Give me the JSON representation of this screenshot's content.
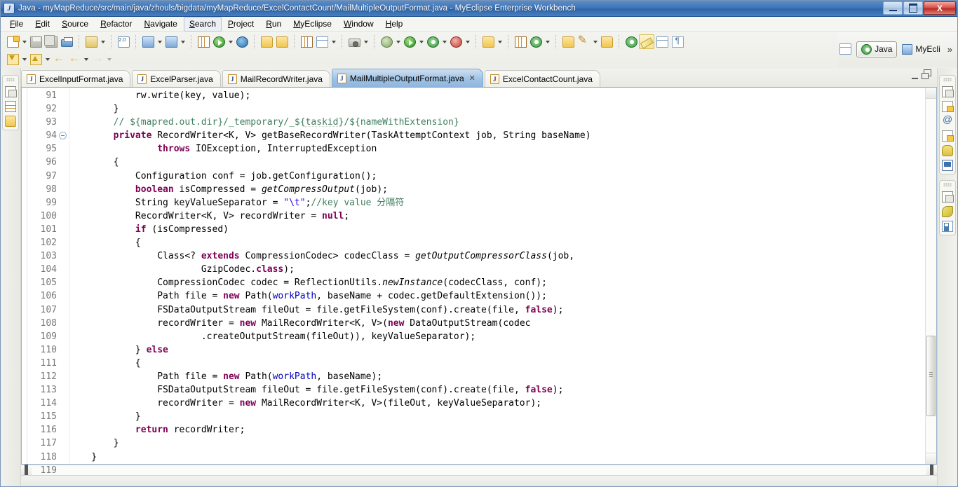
{
  "window": {
    "title": "Java - myMapReduce/src/main/java/zhouls/bigdata/myMapReduce/ExcelContactCount/MailMultipleOutputFormat.java - MyEclipse Enterprise Workbench",
    "app_icon": "myeclipse-icon",
    "buttons": {
      "minimize": "minimize-button",
      "maximize": "maximize-button",
      "close": "X"
    }
  },
  "menubar": {
    "items": [
      {
        "label": "File",
        "active": false
      },
      {
        "label": "Edit",
        "active": false
      },
      {
        "label": "Source",
        "active": false
      },
      {
        "label": "Refactor",
        "active": false
      },
      {
        "label": "Navigate",
        "active": false
      },
      {
        "label": "Search",
        "active": true
      },
      {
        "label": "Project",
        "active": false
      },
      {
        "label": "Run",
        "active": false
      },
      {
        "label": "MyEclipse",
        "active": false
      },
      {
        "label": "Window",
        "active": false
      },
      {
        "label": "Help",
        "active": false
      }
    ]
  },
  "perspective": {
    "open_perspective": "open-perspective-icon",
    "items": [
      {
        "label": "Java",
        "selected": true,
        "icon": "java-perspective-icon"
      },
      {
        "label": "MyEcli",
        "selected": false,
        "icon": "myeclipse-perspective-icon"
      }
    ],
    "overflow": "»"
  },
  "tabs": [
    {
      "label": "ExcelInputFormat.java",
      "active": false,
      "closable": false,
      "icon": "java-file-icon"
    },
    {
      "label": "ExcelParser.java",
      "active": false,
      "closable": false,
      "icon": "java-file-icon"
    },
    {
      "label": "MailRecordWriter.java",
      "active": false,
      "closable": false,
      "icon": "java-file-icon"
    },
    {
      "label": "MailMultipleOutputFormat.java",
      "active": true,
      "closable": true,
      "close_glyph": "✕",
      "icon": "java-file-icon"
    },
    {
      "label": "ExcelContactCount.java",
      "active": false,
      "closable": false,
      "icon": "java-file-warning-icon"
    }
  ],
  "editor_tools": {
    "minimize": "minimize-editor",
    "maximize": "maximize-editor"
  },
  "fastview_left": {
    "items": [
      {
        "name": "restore-view-icon"
      },
      {
        "name": "package-explorer-icon"
      },
      {
        "name": "navigator-icon"
      }
    ]
  },
  "fastview_right": {
    "group_one": [
      {
        "name": "restore-view-icon"
      },
      {
        "name": "problems-view-icon"
      },
      {
        "name": "at-sign-icon"
      },
      {
        "name": "task-list-icon"
      },
      {
        "name": "hadoop-elephant-icon"
      },
      {
        "name": "console-view-icon"
      }
    ],
    "group_two": [
      {
        "name": "restore-view-icon"
      },
      {
        "name": "leaf-icon"
      },
      {
        "name": "outline-view-icon"
      }
    ]
  },
  "editor": {
    "first_line": 91,
    "lines": [
      {
        "n": 91,
        "fold": false,
        "tokens": [
          {
            "t": "            rw.write(key, value);",
            "c": ""
          }
        ]
      },
      {
        "n": 92,
        "fold": false,
        "tokens": [
          {
            "t": "        }",
            "c": ""
          }
        ]
      },
      {
        "n": 93,
        "fold": false,
        "tokens": [
          {
            "t": "        // ${mapred.out.dir}/_temporary/_${",
            "c": "cm"
          },
          {
            "t": "taskid",
            "c": "cm squig"
          },
          {
            "t": "}/${nameWithExtension}",
            "c": "cm"
          }
        ]
      },
      {
        "n": 94,
        "fold": true,
        "tokens": [
          {
            "t": "        ",
            "c": ""
          },
          {
            "t": "private",
            "c": "kw"
          },
          {
            "t": " RecordWriter<K, V> getBaseRecordWriter(TaskAttemptContext job, String baseName)",
            "c": ""
          }
        ]
      },
      {
        "n": 95,
        "fold": false,
        "tokens": [
          {
            "t": "                ",
            "c": ""
          },
          {
            "t": "throws",
            "c": "kw"
          },
          {
            "t": " IOException, InterruptedException",
            "c": ""
          }
        ]
      },
      {
        "n": 96,
        "fold": false,
        "tokens": [
          {
            "t": "        {",
            "c": ""
          }
        ]
      },
      {
        "n": 97,
        "fold": false,
        "tokens": [
          {
            "t": "            Configuration conf = job.getConfiguration();",
            "c": ""
          }
        ]
      },
      {
        "n": 98,
        "fold": false,
        "tokens": [
          {
            "t": "            ",
            "c": ""
          },
          {
            "t": "boolean",
            "c": "kw"
          },
          {
            "t": " isCompressed = ",
            "c": ""
          },
          {
            "t": "getCompressOutput",
            "c": "mth"
          },
          {
            "t": "(job);",
            "c": ""
          }
        ]
      },
      {
        "n": 99,
        "fold": false,
        "tokens": [
          {
            "t": "            String keyValueSeparator = ",
            "c": ""
          },
          {
            "t": "\"\\t\"",
            "c": "st"
          },
          {
            "t": ";",
            "c": ""
          },
          {
            "t": "//key value 分隔符",
            "c": "cm"
          }
        ]
      },
      {
        "n": 100,
        "fold": false,
        "tokens": [
          {
            "t": "            RecordWriter<K, V> recordWriter = ",
            "c": ""
          },
          {
            "t": "null",
            "c": "kw"
          },
          {
            "t": ";",
            "c": ""
          }
        ]
      },
      {
        "n": 101,
        "fold": false,
        "tokens": [
          {
            "t": "            ",
            "c": ""
          },
          {
            "t": "if",
            "c": "kw"
          },
          {
            "t": " (isCompressed)",
            "c": ""
          }
        ]
      },
      {
        "n": 102,
        "fold": false,
        "tokens": [
          {
            "t": "            {",
            "c": ""
          }
        ]
      },
      {
        "n": 103,
        "fold": false,
        "tokens": [
          {
            "t": "                Class<? ",
            "c": ""
          },
          {
            "t": "extends",
            "c": "kw"
          },
          {
            "t": " CompressionCodec> codecClass = ",
            "c": ""
          },
          {
            "t": "getOutputCompressorClass",
            "c": "mth"
          },
          {
            "t": "(job,",
            "c": ""
          }
        ]
      },
      {
        "n": 104,
        "fold": false,
        "tokens": [
          {
            "t": "                        GzipCodec.",
            "c": ""
          },
          {
            "t": "class",
            "c": "kw"
          },
          {
            "t": ");",
            "c": ""
          }
        ]
      },
      {
        "n": 105,
        "fold": false,
        "tokens": [
          {
            "t": "                CompressionCodec codec = ReflectionUtils.",
            "c": ""
          },
          {
            "t": "newInstance",
            "c": "mth"
          },
          {
            "t": "(codecClass, conf);",
            "c": ""
          }
        ]
      },
      {
        "n": 106,
        "fold": false,
        "tokens": [
          {
            "t": "                Path file = ",
            "c": ""
          },
          {
            "t": "new",
            "c": "kw"
          },
          {
            "t": " Path(",
            "c": ""
          },
          {
            "t": "workPath",
            "c": "fld"
          },
          {
            "t": ", baseName + codec.getDefaultExtension());",
            "c": ""
          }
        ]
      },
      {
        "n": 107,
        "fold": false,
        "tokens": [
          {
            "t": "                FSDataOutputStream fileOut = file.getFileSystem(conf).create(file, ",
            "c": ""
          },
          {
            "t": "false",
            "c": "kw"
          },
          {
            "t": ");",
            "c": ""
          }
        ]
      },
      {
        "n": 108,
        "fold": false,
        "tokens": [
          {
            "t": "                recordWriter = ",
            "c": ""
          },
          {
            "t": "new",
            "c": "kw"
          },
          {
            "t": " MailRecordWriter<K, V>(",
            "c": ""
          },
          {
            "t": "new",
            "c": "kw"
          },
          {
            "t": " DataOutputStream(codec",
            "c": ""
          }
        ]
      },
      {
        "n": 109,
        "fold": false,
        "tokens": [
          {
            "t": "                        .createOutputStream(fileOut)), keyValueSeparator);",
            "c": ""
          }
        ]
      },
      {
        "n": 110,
        "fold": false,
        "tokens": [
          {
            "t": "            } ",
            "c": ""
          },
          {
            "t": "else",
            "c": "kw"
          }
        ]
      },
      {
        "n": 111,
        "fold": false,
        "tokens": [
          {
            "t": "            {",
            "c": ""
          }
        ]
      },
      {
        "n": 112,
        "fold": false,
        "tokens": [
          {
            "t": "                Path file = ",
            "c": ""
          },
          {
            "t": "new",
            "c": "kw"
          },
          {
            "t": " Path(",
            "c": ""
          },
          {
            "t": "workPath",
            "c": "fld"
          },
          {
            "t": ", baseName);",
            "c": ""
          }
        ]
      },
      {
        "n": 113,
        "fold": false,
        "tokens": [
          {
            "t": "                FSDataOutputStream fileOut = file.getFileSystem(conf).create(file, ",
            "c": ""
          },
          {
            "t": "false",
            "c": "kw"
          },
          {
            "t": ");",
            "c": ""
          }
        ]
      },
      {
        "n": 114,
        "fold": false,
        "tokens": [
          {
            "t": "                recordWriter = ",
            "c": ""
          },
          {
            "t": "new",
            "c": "kw"
          },
          {
            "t": " MailRecordWriter<K, V>(fileOut, keyValueSeparator);",
            "c": ""
          }
        ]
      },
      {
        "n": 115,
        "fold": false,
        "tokens": [
          {
            "t": "            }",
            "c": ""
          }
        ]
      },
      {
        "n": 116,
        "fold": false,
        "tokens": [
          {
            "t": "            ",
            "c": ""
          },
          {
            "t": "return",
            "c": "kw"
          },
          {
            "t": " recordWriter;",
            "c": ""
          }
        ]
      },
      {
        "n": 117,
        "fold": false,
        "tokens": [
          {
            "t": "        }",
            "c": ""
          }
        ]
      },
      {
        "n": 118,
        "fold": false,
        "tokens": [
          {
            "t": "    }",
            "c": ""
          }
        ]
      },
      {
        "n": 119,
        "fold": false,
        "tokens": [
          {
            "t": "}",
            "c": ""
          }
        ]
      }
    ]
  },
  "toolbar": {
    "row1": [
      {
        "type": "button",
        "name": "new-wizard-button",
        "icon": "doc"
      },
      {
        "type": "arrow",
        "name": "new-wizard-dropdown"
      },
      {
        "type": "button",
        "name": "save-button",
        "icon": "save"
      },
      {
        "type": "button",
        "name": "save-all-button",
        "icon": "saveall"
      },
      {
        "type": "button",
        "name": "print-button",
        "icon": "print"
      },
      {
        "type": "sep"
      },
      {
        "type": "button",
        "name": "new-myeclipse-project-button",
        "icon": "sq"
      },
      {
        "type": "arrow",
        "name": "new-myeclipse-project-dropdown"
      },
      {
        "type": "sep"
      },
      {
        "type": "button",
        "name": "web-2-button",
        "icon": "twoo"
      },
      {
        "type": "sep"
      },
      {
        "type": "button",
        "name": "deploy-button",
        "icon": "blue"
      },
      {
        "type": "arrow",
        "name": "deploy-dropdown"
      },
      {
        "type": "button",
        "name": "server-button",
        "icon": "blue"
      },
      {
        "type": "arrow",
        "name": "server-dropdown"
      },
      {
        "type": "sep"
      },
      {
        "type": "button",
        "name": "database-explorer-button",
        "icon": "grid"
      },
      {
        "type": "button",
        "name": "run-db-button",
        "icon": "green"
      },
      {
        "type": "arrow",
        "name": "run-db-dropdown"
      },
      {
        "type": "button",
        "name": "open-browser-button",
        "icon": "globe"
      },
      {
        "type": "sep"
      },
      {
        "type": "button",
        "name": "open-type-button",
        "icon": "folder"
      },
      {
        "type": "button",
        "name": "open-task-button",
        "icon": "folder"
      },
      {
        "type": "sep"
      },
      {
        "type": "button",
        "name": "report-button",
        "icon": "grid"
      },
      {
        "type": "button",
        "name": "report-preview-button",
        "icon": "persp"
      },
      {
        "type": "arrow",
        "name": "report-dropdown"
      },
      {
        "type": "sep"
      },
      {
        "type": "button",
        "name": "screenshot-button",
        "icon": "cam"
      },
      {
        "type": "arrow",
        "name": "screenshot-dropdown"
      },
      {
        "type": "sep"
      },
      {
        "type": "button",
        "name": "debug-button",
        "icon": "bug"
      },
      {
        "type": "arrow",
        "name": "debug-dropdown"
      },
      {
        "type": "button",
        "name": "run-button",
        "icon": "green"
      },
      {
        "type": "arrow",
        "name": "run-dropdown"
      },
      {
        "type": "button",
        "name": "run-history-button",
        "icon": "tgt"
      },
      {
        "type": "arrow",
        "name": "run-history-dropdown"
      },
      {
        "type": "button",
        "name": "run-external-tools-button",
        "icon": "red"
      },
      {
        "type": "arrow",
        "name": "external-tools-dropdown"
      },
      {
        "type": "sep"
      },
      {
        "type": "button",
        "name": "new-java-package-button",
        "icon": "folder"
      },
      {
        "type": "arrow",
        "name": "new-java-package-dropdown"
      },
      {
        "type": "sep"
      },
      {
        "type": "button",
        "name": "new-class-button",
        "icon": "grid"
      },
      {
        "type": "button",
        "name": "new-annotation-button",
        "icon": "tgt"
      },
      {
        "type": "arrow",
        "name": "new-annotation-dropdown"
      },
      {
        "type": "sep"
      },
      {
        "type": "button",
        "name": "search-resource-button",
        "icon": "folder"
      },
      {
        "type": "button",
        "name": "search-button",
        "icon": "pencil"
      },
      {
        "type": "arrow",
        "name": "search-dropdown"
      },
      {
        "type": "button",
        "name": "open-resource-button",
        "icon": "folder"
      },
      {
        "type": "sep"
      },
      {
        "type": "button",
        "name": "next-annotation-button",
        "icon": "tgt"
      },
      {
        "type": "button",
        "name": "toggle-mark-occurrences-button",
        "icon": "marker",
        "pressed": true
      },
      {
        "type": "button",
        "name": "toggle-block-selection-button",
        "icon": "persp"
      },
      {
        "type": "button",
        "name": "show-whitespace-button",
        "icon": "para"
      }
    ],
    "row2": [
      {
        "type": "button",
        "name": "step-into-button",
        "icon": "dl"
      },
      {
        "type": "arrow",
        "name": "step-into-dropdown"
      },
      {
        "type": "button",
        "name": "step-return-button",
        "icon": "up"
      },
      {
        "type": "arrow",
        "name": "step-return-dropdown"
      },
      {
        "type": "button",
        "name": "back-history-button",
        "icon": "arrowL"
      },
      {
        "type": "button",
        "name": "back-button",
        "icon": "arrowL"
      },
      {
        "type": "arrow",
        "name": "back-dropdown"
      },
      {
        "type": "button",
        "name": "forward-button",
        "icon": "arrowR"
      },
      {
        "type": "arrow",
        "name": "forward-dropdown",
        "dim": true
      }
    ]
  }
}
